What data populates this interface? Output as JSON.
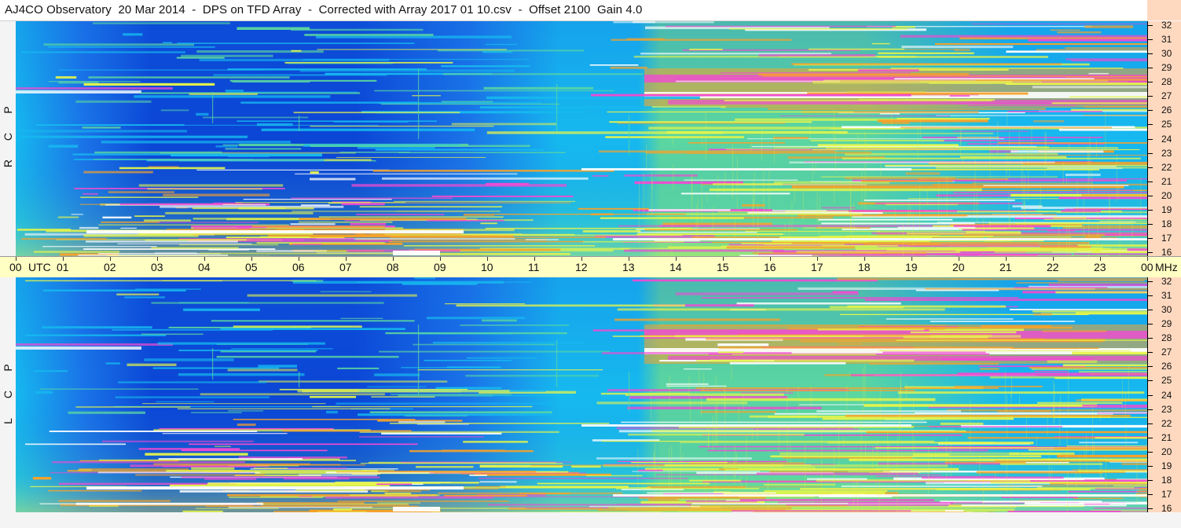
{
  "title": "AJ4CO Observatory  20 Mar 2014  -  DPS on TFD Array  -  Corrected with Array 2017 01 10.csv  -  Offset 2100  Gain 4.0",
  "panels": [
    {
      "id": "rcp",
      "polarization_letters": [
        "R",
        "C",
        "P"
      ]
    },
    {
      "id": "lcp",
      "polarization_letters": [
        "L",
        "C",
        "P"
      ]
    }
  ],
  "time_axis": {
    "hours": [
      "00",
      "01",
      "02",
      "03",
      "04",
      "05",
      "06",
      "07",
      "08",
      "09",
      "10",
      "11",
      "12",
      "13",
      "14",
      "15",
      "16",
      "17",
      "18",
      "19",
      "20",
      "21",
      "22",
      "23",
      "00"
    ],
    "utc_label": "UTC",
    "mhz_label": "MHz"
  },
  "freq_axis": {
    "labels": [
      "32",
      "31",
      "30",
      "29",
      "28",
      "27",
      "26",
      "25",
      "24",
      "23",
      "22",
      "21",
      "20",
      "19",
      "18",
      "17",
      "16"
    ],
    "unit": "MHz"
  },
  "colors": {
    "deep_blue": "#0b46d6",
    "blue": "#1a74e8",
    "cyan": "#16b9ef",
    "green": "#5bd7a0",
    "yellow": "#e6f54a",
    "orange": "#f7a22a",
    "magenta": "#f04bd2",
    "white": "#ffffff",
    "axis_bg": "#ffffc4",
    "freq_axis_bg": "#ffd9bf"
  }
}
